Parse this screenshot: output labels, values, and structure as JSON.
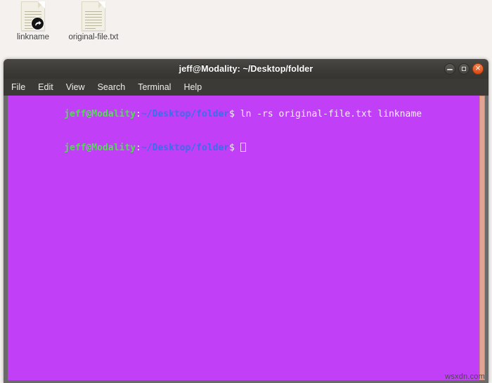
{
  "desktop": {
    "background_color": "#f4f1ef",
    "icons": [
      {
        "label": "linkname",
        "icon": "symlink-document-icon",
        "emblem": "link-arrow-emblem"
      },
      {
        "label": "original-file.txt",
        "icon": "text-document-icon",
        "emblem": ""
      }
    ]
  },
  "terminal": {
    "title": "jeff@Modality: ~/Desktop/folder",
    "titlebar_color": "#3b3a36",
    "background_color": "#c13ff7",
    "window_controls": [
      {
        "name": "minimize",
        "glyph": "–"
      },
      {
        "name": "maximize",
        "glyph": "□"
      },
      {
        "name": "close",
        "glyph": "✕"
      }
    ],
    "menu": [
      {
        "label": "File"
      },
      {
        "label": "Edit"
      },
      {
        "label": "View"
      },
      {
        "label": "Search"
      },
      {
        "label": "Terminal"
      },
      {
        "label": "Help"
      }
    ],
    "prompt": {
      "user_host": "jeff@Modality",
      "colon": ":",
      "path": "~/Desktop/folder",
      "symbol": "$",
      "user_host_color": "#4fdf4f",
      "path_color": "#3a6fe8"
    },
    "lines": [
      {
        "command": "ln -rs original-file.txt linkname",
        "has_cursor": false
      },
      {
        "command": "",
        "has_cursor": true
      }
    ]
  },
  "watermark": {
    "text": "wsxdn.com"
  }
}
